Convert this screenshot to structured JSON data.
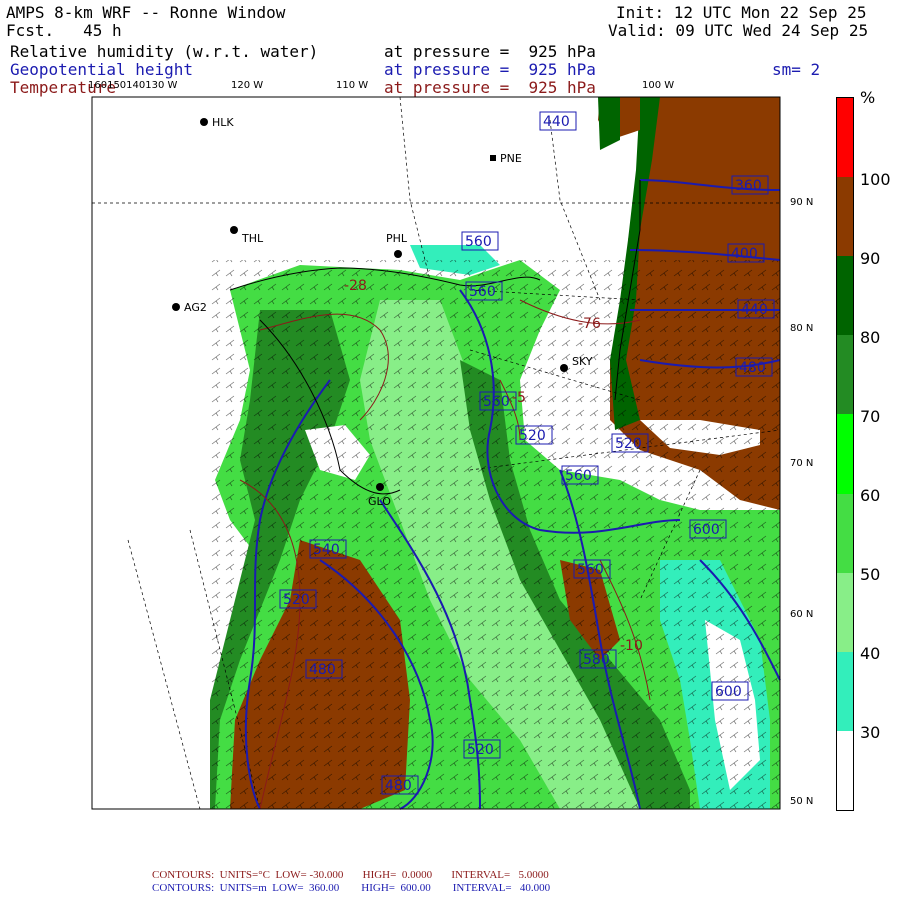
{
  "header": {
    "model": "AMPS 8-km WRF -- Ronne Window",
    "forecast": "Fcst.   45 h",
    "init": "Init: 12 UTC Mon 22 Sep 25",
    "valid": "Valid: 09 UTC Wed 24 Sep 25",
    "field1": "Relative humidity (w.r.t. water)",
    "field2": "Geopotential height",
    "field3": "Temperature",
    "level1": "at pressure =  925 hPa",
    "level2": "at pressure =  925 hPa",
    "level3": "at pressure =  925 hPa",
    "smoothing": "sm= 2"
  },
  "lon_labels": [
    "160150140130 W",
    "120 W",
    "110 W",
    "100 W"
  ],
  "lat_labels": [
    "90 N",
    "80 N",
    "70 N",
    "60 N",
    "50 N"
  ],
  "stations": [
    {
      "name": "HLK"
    },
    {
      "name": "PNE"
    },
    {
      "name": "THL"
    },
    {
      "name": "PHL"
    },
    {
      "name": "AG2"
    },
    {
      "name": "SKY"
    },
    {
      "name": "GLO"
    }
  ],
  "height_contour_labels": [
    "440",
    "360",
    "400",
    "440",
    "480",
    "560",
    "560",
    "560",
    "520",
    "520",
    "560",
    "540",
    "520",
    "560",
    "580",
    "600",
    "520",
    "480",
    "480",
    "600"
  ],
  "temperature_contour_labels": [
    "-28",
    "-76",
    "-5",
    "-10"
  ],
  "colorbar": {
    "unit": "%",
    "labels": [
      "100",
      "90",
      "80",
      "70",
      "60",
      "50",
      "40",
      "30"
    ],
    "colors": [
      "#ff0000",
      "#8b3a00",
      "#006400",
      "#238b23",
      "#00ff00",
      "#44dd44",
      "#88ee88",
      "#33eebb",
      "#ffffff"
    ]
  },
  "footer": {
    "temp_line": "CONTOURS:  UNITS=°C  LOW= -30.000       HIGH=  0.0000       INTERVAL=   5.0000",
    "height_line": "CONTOURS:  UNITS=m  LOW=  360.00        HIGH=  600.00        INTERVAL=   40.000"
  }
}
